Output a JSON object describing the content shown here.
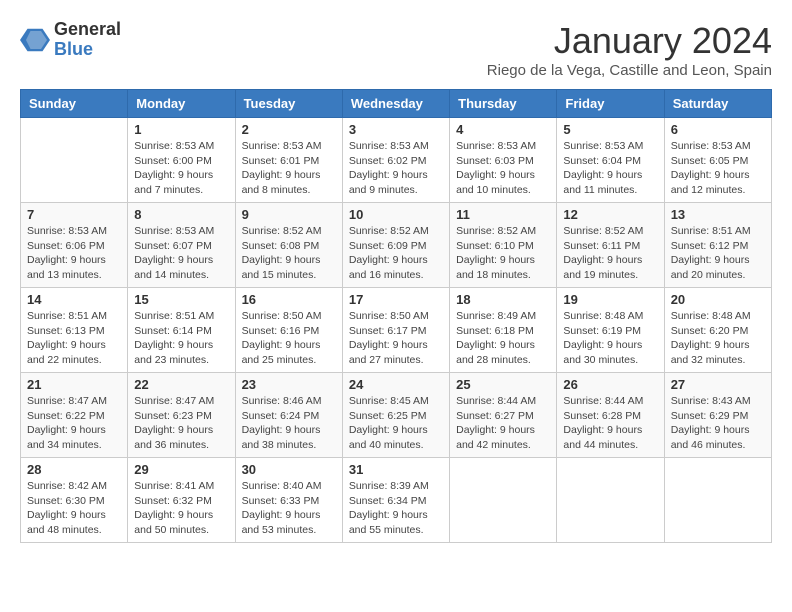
{
  "logo": {
    "general": "General",
    "blue": "Blue"
  },
  "header": {
    "title": "January 2024",
    "subtitle": "Riego de la Vega, Castille and Leon, Spain"
  },
  "weekdays": [
    "Sunday",
    "Monday",
    "Tuesday",
    "Wednesday",
    "Thursday",
    "Friday",
    "Saturday"
  ],
  "weeks": [
    [
      {
        "day": "",
        "info": ""
      },
      {
        "day": "1",
        "info": "Sunrise: 8:53 AM\nSunset: 6:00 PM\nDaylight: 9 hours\nand 7 minutes."
      },
      {
        "day": "2",
        "info": "Sunrise: 8:53 AM\nSunset: 6:01 PM\nDaylight: 9 hours\nand 8 minutes."
      },
      {
        "day": "3",
        "info": "Sunrise: 8:53 AM\nSunset: 6:02 PM\nDaylight: 9 hours\nand 9 minutes."
      },
      {
        "day": "4",
        "info": "Sunrise: 8:53 AM\nSunset: 6:03 PM\nDaylight: 9 hours\nand 10 minutes."
      },
      {
        "day": "5",
        "info": "Sunrise: 8:53 AM\nSunset: 6:04 PM\nDaylight: 9 hours\nand 11 minutes."
      },
      {
        "day": "6",
        "info": "Sunrise: 8:53 AM\nSunset: 6:05 PM\nDaylight: 9 hours\nand 12 minutes."
      }
    ],
    [
      {
        "day": "7",
        "info": "Sunrise: 8:53 AM\nSunset: 6:06 PM\nDaylight: 9 hours\nand 13 minutes."
      },
      {
        "day": "8",
        "info": "Sunrise: 8:53 AM\nSunset: 6:07 PM\nDaylight: 9 hours\nand 14 minutes."
      },
      {
        "day": "9",
        "info": "Sunrise: 8:52 AM\nSunset: 6:08 PM\nDaylight: 9 hours\nand 15 minutes."
      },
      {
        "day": "10",
        "info": "Sunrise: 8:52 AM\nSunset: 6:09 PM\nDaylight: 9 hours\nand 16 minutes."
      },
      {
        "day": "11",
        "info": "Sunrise: 8:52 AM\nSunset: 6:10 PM\nDaylight: 9 hours\nand 18 minutes."
      },
      {
        "day": "12",
        "info": "Sunrise: 8:52 AM\nSunset: 6:11 PM\nDaylight: 9 hours\nand 19 minutes."
      },
      {
        "day": "13",
        "info": "Sunrise: 8:51 AM\nSunset: 6:12 PM\nDaylight: 9 hours\nand 20 minutes."
      }
    ],
    [
      {
        "day": "14",
        "info": "Sunrise: 8:51 AM\nSunset: 6:13 PM\nDaylight: 9 hours\nand 22 minutes."
      },
      {
        "day": "15",
        "info": "Sunrise: 8:51 AM\nSunset: 6:14 PM\nDaylight: 9 hours\nand 23 minutes."
      },
      {
        "day": "16",
        "info": "Sunrise: 8:50 AM\nSunset: 6:16 PM\nDaylight: 9 hours\nand 25 minutes."
      },
      {
        "day": "17",
        "info": "Sunrise: 8:50 AM\nSunset: 6:17 PM\nDaylight: 9 hours\nand 27 minutes."
      },
      {
        "day": "18",
        "info": "Sunrise: 8:49 AM\nSunset: 6:18 PM\nDaylight: 9 hours\nand 28 minutes."
      },
      {
        "day": "19",
        "info": "Sunrise: 8:48 AM\nSunset: 6:19 PM\nDaylight: 9 hours\nand 30 minutes."
      },
      {
        "day": "20",
        "info": "Sunrise: 8:48 AM\nSunset: 6:20 PM\nDaylight: 9 hours\nand 32 minutes."
      }
    ],
    [
      {
        "day": "21",
        "info": "Sunrise: 8:47 AM\nSunset: 6:22 PM\nDaylight: 9 hours\nand 34 minutes."
      },
      {
        "day": "22",
        "info": "Sunrise: 8:47 AM\nSunset: 6:23 PM\nDaylight: 9 hours\nand 36 minutes."
      },
      {
        "day": "23",
        "info": "Sunrise: 8:46 AM\nSunset: 6:24 PM\nDaylight: 9 hours\nand 38 minutes."
      },
      {
        "day": "24",
        "info": "Sunrise: 8:45 AM\nSunset: 6:25 PM\nDaylight: 9 hours\nand 40 minutes."
      },
      {
        "day": "25",
        "info": "Sunrise: 8:44 AM\nSunset: 6:27 PM\nDaylight: 9 hours\nand 42 minutes."
      },
      {
        "day": "26",
        "info": "Sunrise: 8:44 AM\nSunset: 6:28 PM\nDaylight: 9 hours\nand 44 minutes."
      },
      {
        "day": "27",
        "info": "Sunrise: 8:43 AM\nSunset: 6:29 PM\nDaylight: 9 hours\nand 46 minutes."
      }
    ],
    [
      {
        "day": "28",
        "info": "Sunrise: 8:42 AM\nSunset: 6:30 PM\nDaylight: 9 hours\nand 48 minutes."
      },
      {
        "day": "29",
        "info": "Sunrise: 8:41 AM\nSunset: 6:32 PM\nDaylight: 9 hours\nand 50 minutes."
      },
      {
        "day": "30",
        "info": "Sunrise: 8:40 AM\nSunset: 6:33 PM\nDaylight: 9 hours\nand 53 minutes."
      },
      {
        "day": "31",
        "info": "Sunrise: 8:39 AM\nSunset: 6:34 PM\nDaylight: 9 hours\nand 55 minutes."
      },
      {
        "day": "",
        "info": ""
      },
      {
        "day": "",
        "info": ""
      },
      {
        "day": "",
        "info": ""
      }
    ]
  ],
  "colors": {
    "header_bg": "#3a7abf",
    "header_text": "#ffffff",
    "border": "#cccccc"
  }
}
